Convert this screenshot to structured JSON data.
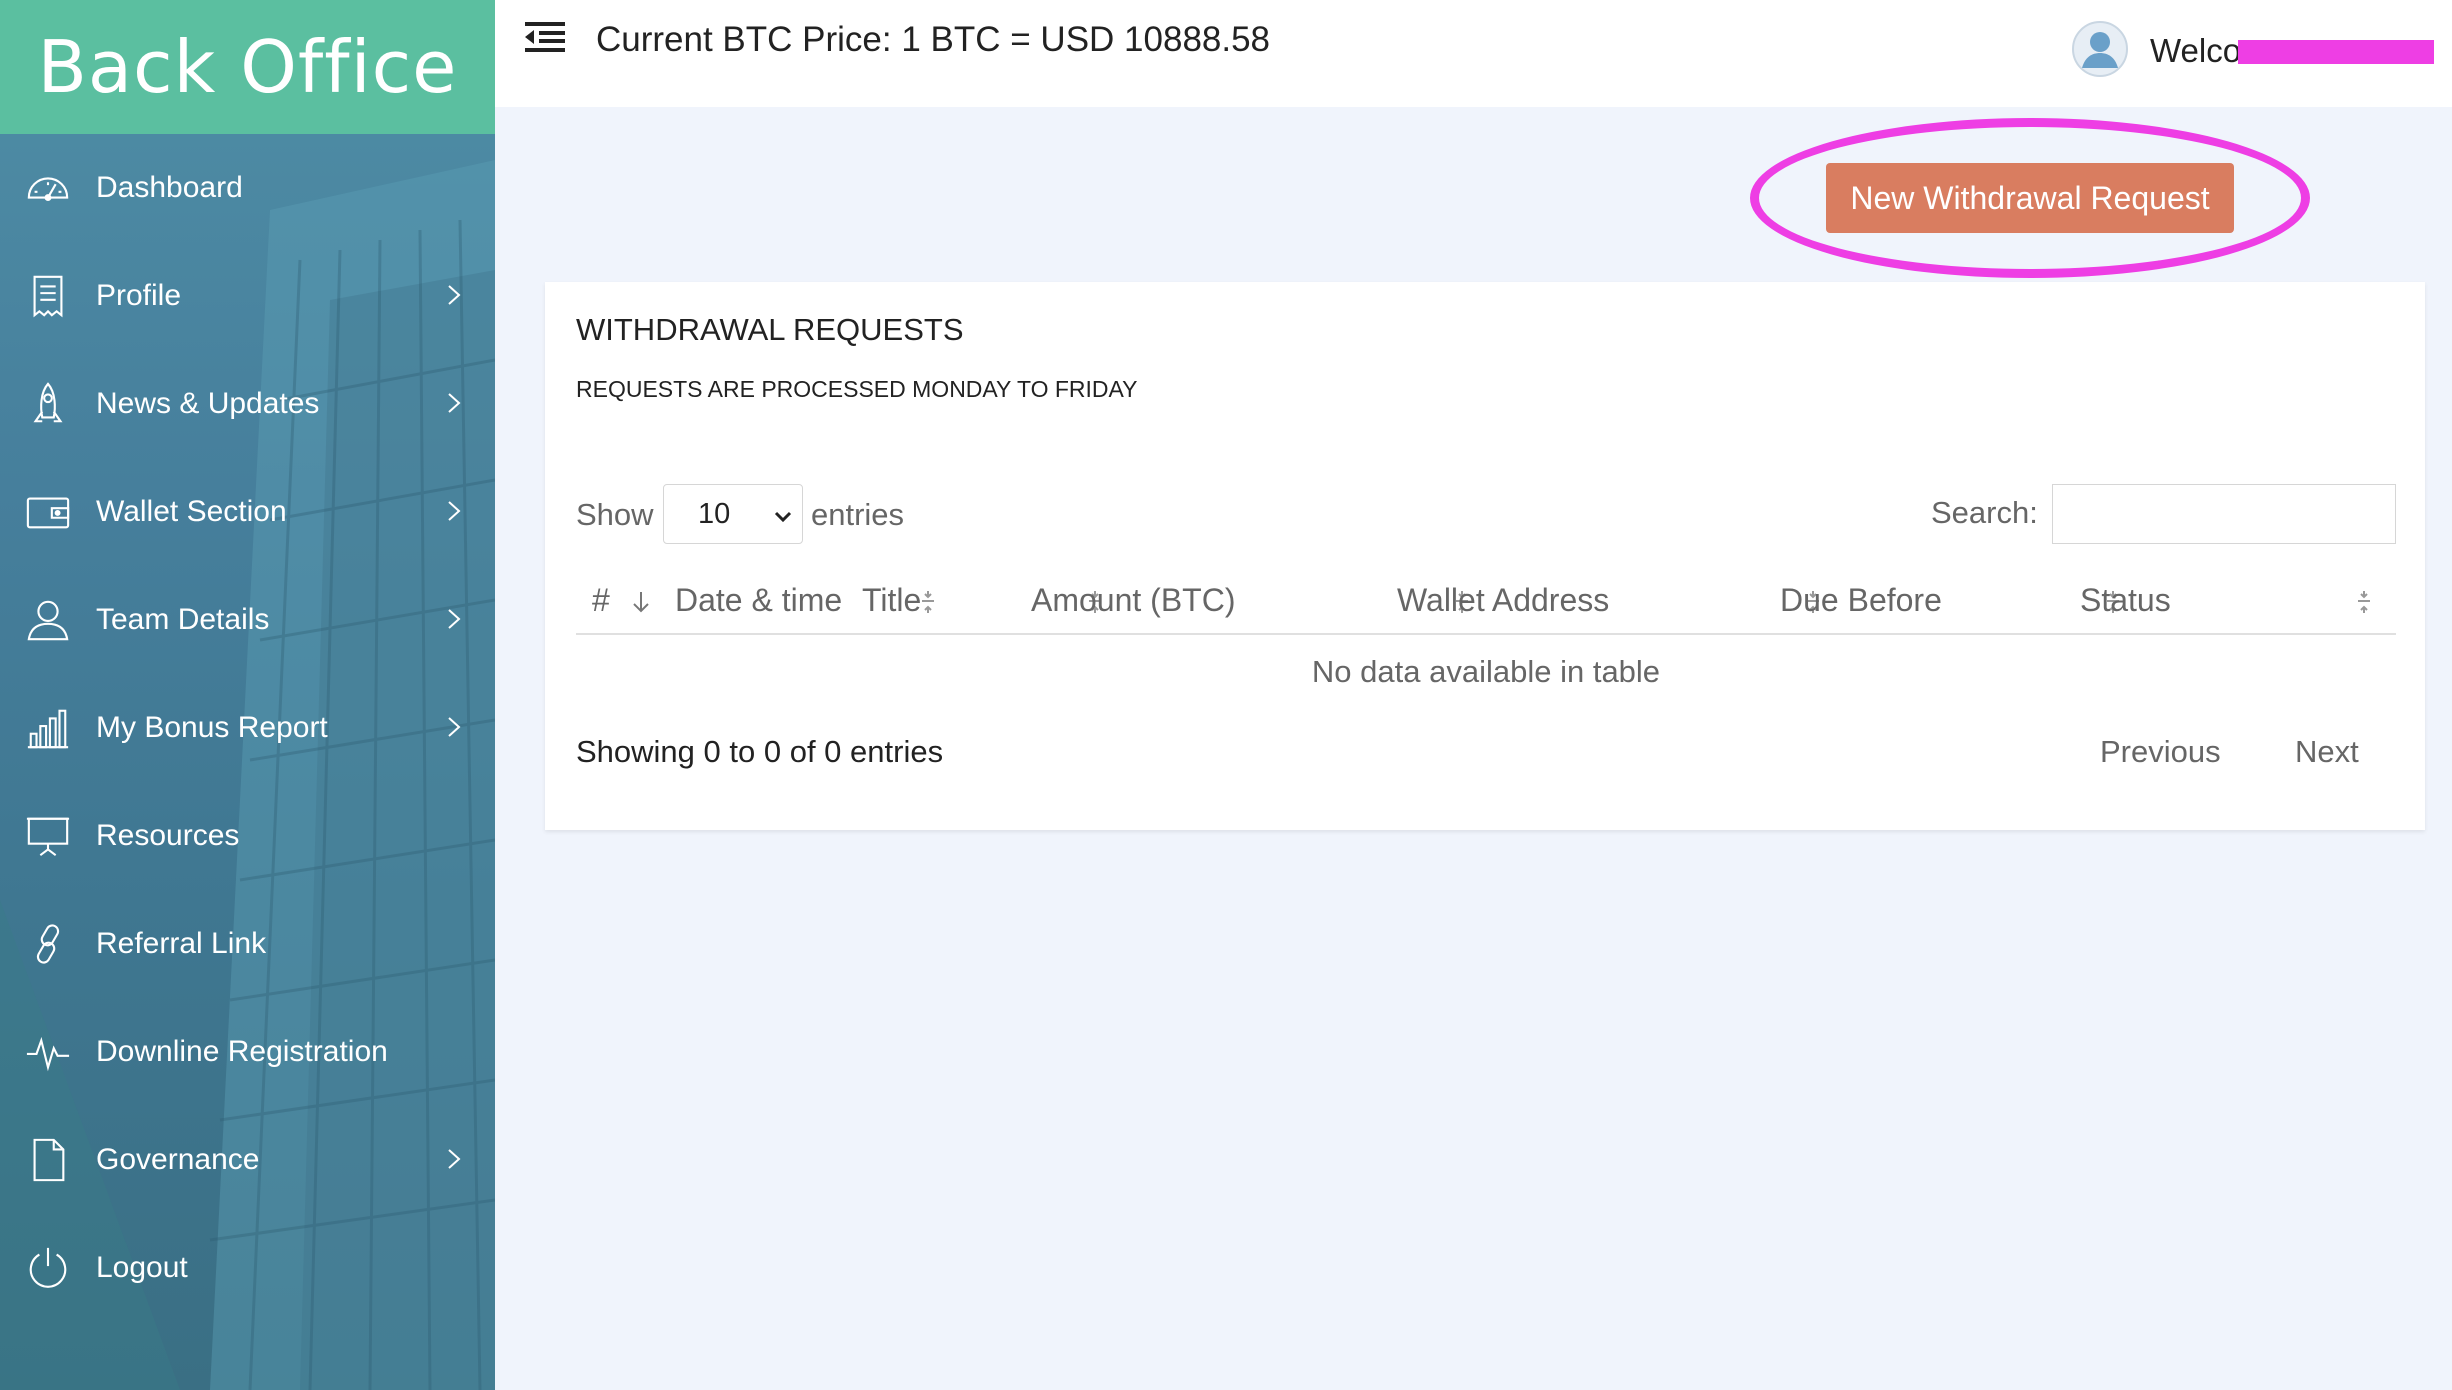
{
  "sidebar": {
    "brand": "Back Office",
    "items": [
      {
        "label": "Dashboard",
        "icon": "dashboard-gauge-icon",
        "has_children": false
      },
      {
        "label": "Profile",
        "icon": "receipt-icon",
        "has_children": true
      },
      {
        "label": "News & Updates",
        "icon": "rocket-icon",
        "has_children": true
      },
      {
        "label": "Wallet Section",
        "icon": "wallet-icon",
        "has_children": true
      },
      {
        "label": "Team Details",
        "icon": "user-icon",
        "has_children": true
      },
      {
        "label": "My Bonus Report",
        "icon": "bar-chart-icon",
        "has_children": true
      },
      {
        "label": "Resources",
        "icon": "presentation-board-icon",
        "has_children": false
      },
      {
        "label": "Referral Link",
        "icon": "link-icon",
        "has_children": false
      },
      {
        "label": "Downline Registration",
        "icon": "pulse-icon",
        "has_children": false
      },
      {
        "label": "Governance",
        "icon": "document-icon",
        "has_children": true
      },
      {
        "label": "Logout",
        "icon": "power-icon",
        "has_children": false
      }
    ]
  },
  "header": {
    "btc_price": "Current BTC Price: 1 BTC = USD 10888.58",
    "welcome": "Welco",
    "redaction_color": "#ee3ee4"
  },
  "actions": {
    "new_request": "New Withdrawal Request",
    "button_color": "#d97d60"
  },
  "card": {
    "title": "WITHDRAWAL REQUESTS",
    "subtitle": "REQUESTS ARE PROCESSED MONDAY TO FRIDAY",
    "show_label": "Show",
    "entries_label": "entries",
    "page_length": "10",
    "search_label": "Search:",
    "search_value": "",
    "columns": [
      "#",
      "Date & time",
      "Title",
      "Amount (BTC)",
      "Wallet Address",
      "Due Before",
      "Status"
    ],
    "empty_message": "No data available in table",
    "info": "Showing 0 to 0 of 0 entries",
    "previous": "Previous",
    "next": "Next"
  },
  "colors": {
    "brand_bg": "#5bbfa0",
    "sidebar_bg": "#467f9c",
    "highlight": "#ee3ee4",
    "page_bg": "#f0f4fc"
  }
}
